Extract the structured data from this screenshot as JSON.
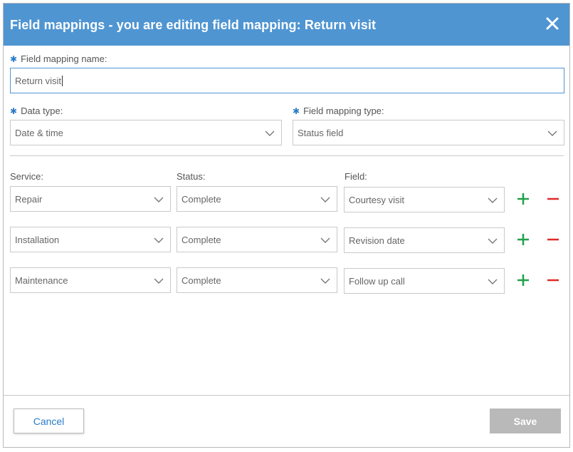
{
  "dialog": {
    "title": "Field mappings - you are editing field mapping: Return visit",
    "close_icon": "close-icon"
  },
  "name_field": {
    "label": "Field mapping name:",
    "value": "Return visit",
    "required_marker": "✱"
  },
  "data_type": {
    "label": "Data type:",
    "value": "Date & time"
  },
  "mapping_type": {
    "label": "Field mapping type:",
    "value": "Status field"
  },
  "columns": {
    "service": "Service:",
    "status": "Status:",
    "field": "Field:"
  },
  "rows": [
    {
      "service": "Repair",
      "status": "Complete",
      "field": "Courtesy visit"
    },
    {
      "service": "Installation",
      "status": "Complete",
      "field": "Revision date"
    },
    {
      "service": "Maintenance",
      "status": "Complete",
      "field": "Follow up call"
    }
  ],
  "footer": {
    "cancel_label": "Cancel",
    "save_label": "Save"
  },
  "colors": {
    "header": "#4f95d2",
    "add": "#22a04a",
    "remove": "#e02a2a",
    "required": "#2a7cc9",
    "save_disabled": "#b9b9b9"
  }
}
